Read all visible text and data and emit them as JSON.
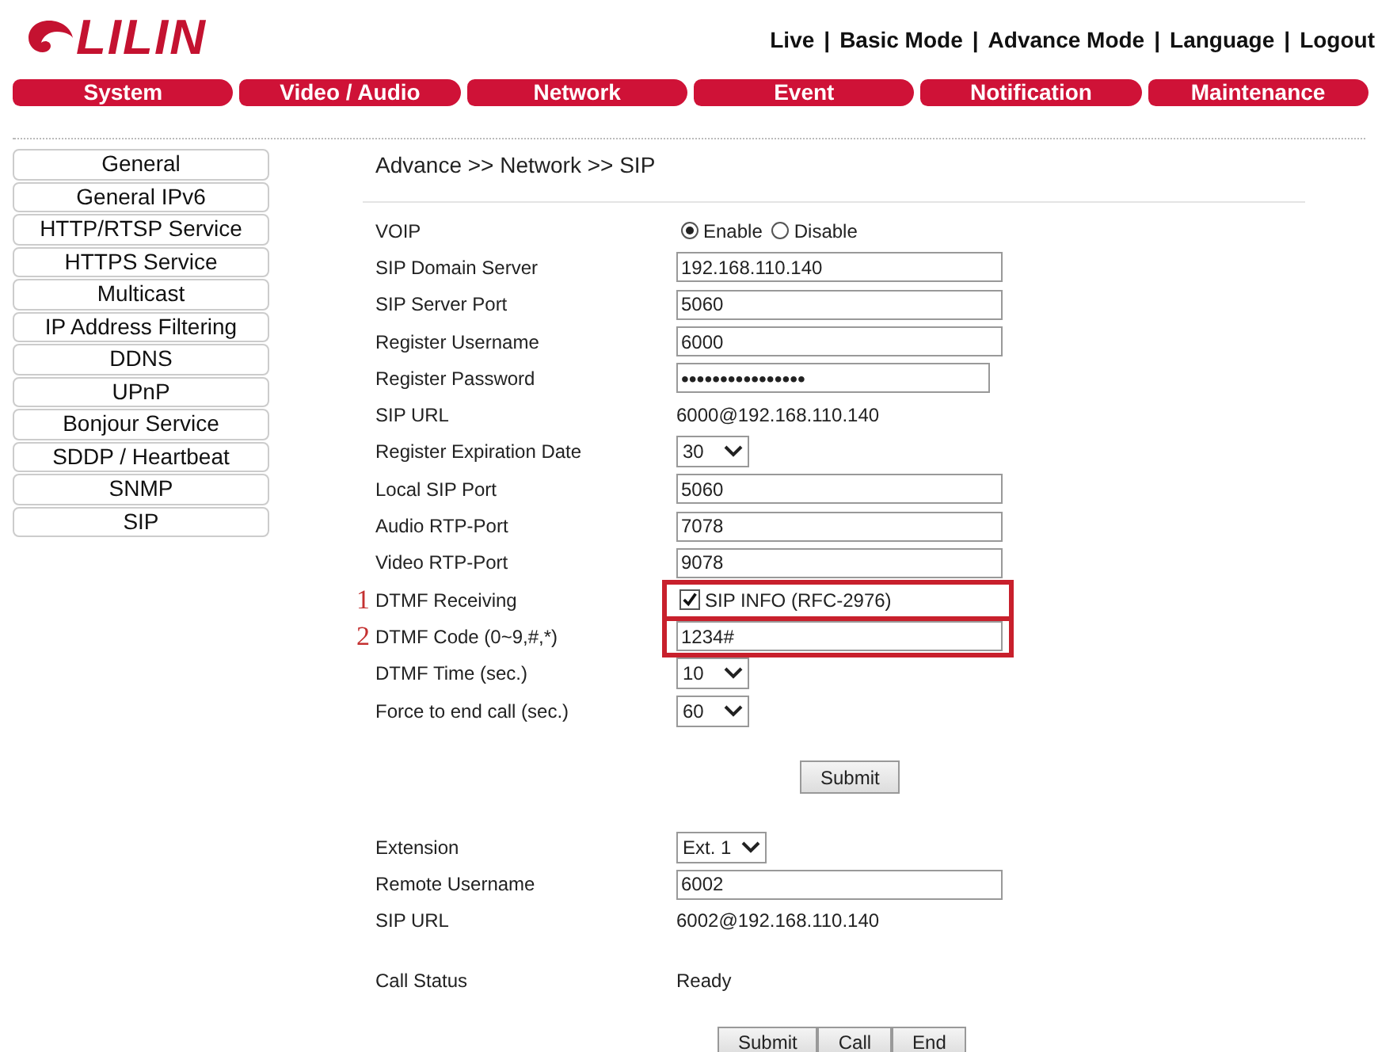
{
  "logo": {
    "text": "LILIN"
  },
  "top_links": [
    "Live",
    "Basic Mode",
    "Advance Mode",
    "Language",
    "Logout"
  ],
  "link_separator": "|",
  "nav_tabs": [
    "System",
    "Video / Audio",
    "Network",
    "Event",
    "Notification",
    "Maintenance"
  ],
  "sidebar": {
    "items": [
      "General",
      "General IPv6",
      "HTTP/RTSP Service",
      "HTTPS Service",
      "Multicast",
      "IP Address Filtering",
      "DDNS",
      "UPnP",
      "Bonjour Service",
      "SDDP / Heartbeat",
      "SNMP",
      "SIP"
    ]
  },
  "breadcrumb": "Advance >> Network >> SIP",
  "settings": [
    {
      "kind": "radio",
      "label": "VOIP",
      "options": [
        {
          "label": "Enable",
          "selected": true
        },
        {
          "label": "Disable",
          "selected": false
        }
      ]
    },
    {
      "kind": "text",
      "label": "SIP Domain Server",
      "value": "192.168.110.140"
    },
    {
      "kind": "text",
      "label": "SIP Server Port",
      "value": "5060"
    },
    {
      "kind": "text",
      "label": "Register Username",
      "value": "6000"
    },
    {
      "kind": "password",
      "label": "Register Password",
      "value": "••••••••••••••••"
    },
    {
      "kind": "static",
      "label": "SIP URL",
      "value": "6000@192.168.110.140"
    },
    {
      "kind": "select",
      "label": "Register Expiration Date",
      "value": "30"
    },
    {
      "kind": "text",
      "label": "Local SIP Port",
      "value": "5060"
    },
    {
      "kind": "text",
      "label": "Audio RTP-Port",
      "value": "7078"
    },
    {
      "kind": "text",
      "label": "Video RTP-Port",
      "value": "9078"
    },
    {
      "kind": "checkbox",
      "label": "DTMF Receiving",
      "option": "SIP INFO (RFC-2976)",
      "checked": true,
      "marker": "1",
      "highlighted": true
    },
    {
      "kind": "text",
      "label": "DTMF Code (0~9,#,*)",
      "value": "1234#",
      "marker": "2",
      "highlighted": true
    },
    {
      "kind": "select",
      "label": "DTMF Time (sec.)",
      "value": "10"
    },
    {
      "kind": "select",
      "label": "Force to end call (sec.)",
      "value": "60"
    }
  ],
  "submit_button": "Submit",
  "call_settings": [
    {
      "kind": "select",
      "label": "Extension",
      "value": "Ext. 1"
    },
    {
      "kind": "text",
      "label": "Remote Username",
      "value": "6002"
    },
    {
      "kind": "static",
      "label": "SIP URL",
      "value": "6002@192.168.110.140"
    },
    {
      "kind": "static",
      "label": "Call Status",
      "value": "Ready",
      "spaced": true
    }
  ],
  "call_buttons": [
    "Submit",
    "Call",
    "End"
  ]
}
